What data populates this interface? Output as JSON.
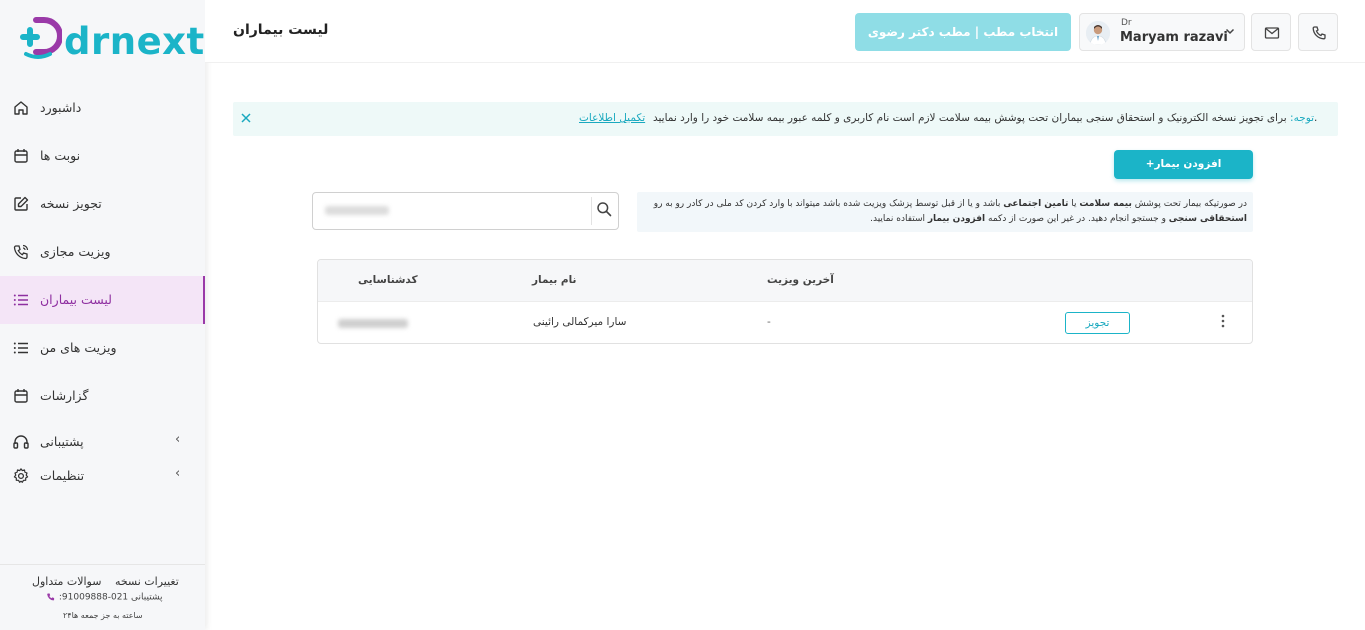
{
  "brand": {
    "logo_text": "drnext",
    "accent": "#1bb4c8",
    "accent_purple": "#9a3aa8"
  },
  "sidebar": {
    "items": [
      {
        "label": "داشبورد",
        "icon": "home-icon"
      },
      {
        "label": "نوبت ها",
        "icon": "calendar-icon"
      },
      {
        "label": "تجویز نسخه",
        "icon": "edit-icon"
      },
      {
        "label": "ویزیت مجازی",
        "icon": "phone-call-icon"
      },
      {
        "label": "لیست بیماران",
        "icon": "list-icon",
        "active": true
      },
      {
        "label": "ویزیت های من",
        "icon": "list-icon"
      },
      {
        "label": "گزارشات",
        "icon": "calendar-icon"
      },
      {
        "label": "پشتیبانی",
        "icon": "headset-icon",
        "expandable": true
      },
      {
        "label": "تنظیمات",
        "icon": "gear-icon",
        "expandable": true
      }
    ],
    "footer": {
      "faq": "سوالات متداول",
      "changelog": "تغییرات نسخه",
      "support_phone": "021-91009888",
      "support_label": ":پشتیبانی",
      "hours": "۲۴ساعته به جز جمعه ها"
    }
  },
  "header": {
    "title": "لیست بیماران",
    "clinic_button": "انتخاب مطب | مطب دکتر رضوی",
    "doctor_prefix": "Dr",
    "doctor_name": "Maryam razavi"
  },
  "notice": {
    "prefix": "توجه:",
    "text": " برای تجویز نسخه الکترونیک و استحقاق سنجی بیماران تحت پوشش بیمه سلامت لازم است نام کاربری و کلمه عبور بیمه سلامت خود را وارد نمایید.",
    "link": "تکمیل اطلاعات"
  },
  "actions": {
    "add_patient": "+افزودن بیمار"
  },
  "search": {
    "placeholder": ""
  },
  "info": {
    "part1": "در صورتیکه بیمار تحت پوشش ",
    "b1": "بیمه سلامت",
    "part2": " یا ",
    "b2": "تامین اجتماعی",
    "part3": " باشد و یا از قبل توسط پزشک ویزیت شده باشد میتواند با وارد کردن کد ملی در کادر رو به رو ",
    "b3": "استحقاقی سنجی",
    "part4": " و جستجو انجام دهید. در غیر این صورت از دکمه ",
    "b4": "افزودن بیمار",
    "part5": " استفاده نمایید."
  },
  "table": {
    "columns": {
      "code": "کدشناسایی",
      "name": "نام بیمار",
      "last_visit": "آخرین ویزیت"
    },
    "rows": [
      {
        "name": "سارا میرکمالی رائینی",
        "last_visit": "-",
        "action": "تجویز"
      }
    ]
  }
}
